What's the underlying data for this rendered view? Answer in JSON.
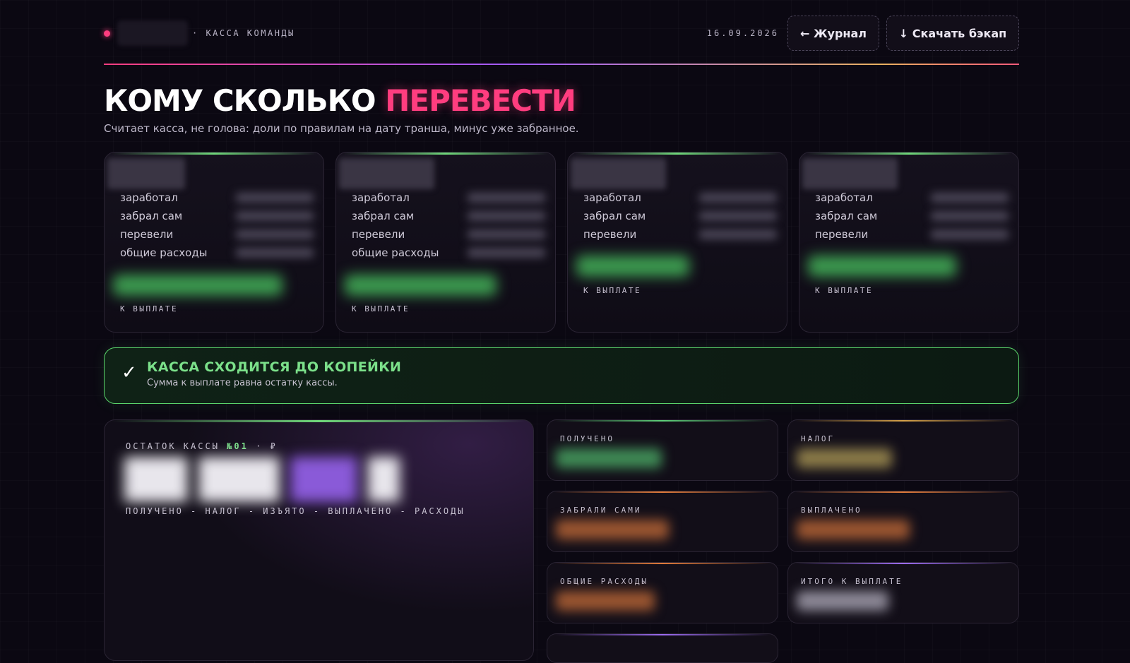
{
  "header": {
    "brand_subtitle": "· КАССА КОМАНДЫ",
    "date": "16.09.2026",
    "journal_button": "← Журнал",
    "backup_button": "↓ Скачать бэкап"
  },
  "title": {
    "main": "КОМУ СКОЛЬКО",
    "accent": "ПЕРЕВЕСТИ",
    "subtitle": "Считает касса, не голова: доли по правилам на дату транша, минус уже забранное."
  },
  "people": [
    {
      "rows": [
        "заработал",
        "забрал сам",
        "перевели",
        "общие расходы"
      ],
      "payout_label": "К ВЫПЛАТЕ"
    },
    {
      "rows": [
        "заработал",
        "забрал сам",
        "перевели",
        "общие расходы"
      ],
      "payout_label": "К ВЫПЛАТЕ"
    },
    {
      "rows": [
        "заработал",
        "забрал сам",
        "перевели"
      ],
      "payout_label": "К ВЫПЛАТЕ"
    },
    {
      "rows": [
        "заработал",
        "забрал сам",
        "перевели"
      ],
      "payout_label": "К ВЫПЛАТЕ"
    }
  ],
  "banner": {
    "title": "КАССА СХОДИТСЯ ДО КОПЕЙКИ",
    "subtitle": "Сумма к выплате равна остатку кассы."
  },
  "balance": {
    "label": "ОСТАТОК КАССЫ",
    "number": "№01",
    "currency": "· ₽",
    "formula": "ПОЛУЧЕНО - НАЛОГ - ИЗЪЯТО - ВЫПЛАЧЕНО - РАСХОДЫ"
  },
  "stats": [
    {
      "label": "ПОЛУЧЕНО",
      "color": "#5fd07a"
    },
    {
      "label": "НАЛОГ",
      "color": "#d6a24a"
    },
    {
      "label": "ЗАБРАЛИ САМИ",
      "color": "#e07a3a"
    },
    {
      "label": "ВЫПЛАЧЕНО",
      "color": "#e07a3a"
    },
    {
      "label": "ОБЩИЕ РАСХОДЫ",
      "color": "#e07a3a"
    },
    {
      "label": "ИТОГО К ВЫПЛАТЕ",
      "color": "#9c6cf0"
    }
  ],
  "colors": {
    "accent": "#ff3d7f",
    "success": "#7be08a",
    "background": "#0b0812"
  }
}
